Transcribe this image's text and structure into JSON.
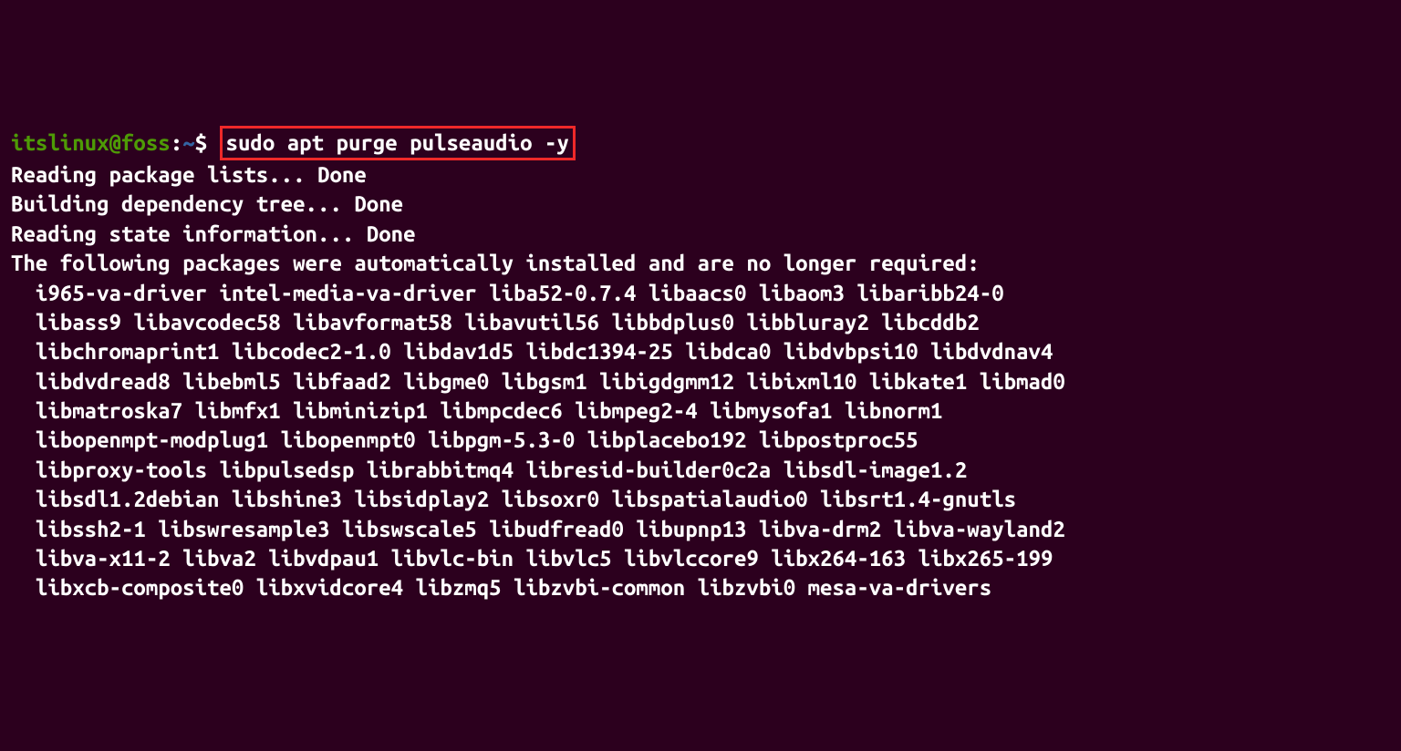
{
  "prompt": {
    "user_host": "itslinux@foss",
    "separator": ":",
    "path": "~",
    "dollar": "$"
  },
  "command": "sudo apt purge pulseaudio -y",
  "output": {
    "line1": "Reading package lists... Done",
    "line2": "Building dependency tree... Done",
    "line3": "Reading state information... Done",
    "line4": "The following packages were automatically installed and are no longer required:",
    "packages": {
      "row1": "i965-va-driver intel-media-va-driver liba52-0.7.4 libaacs0 libaom3 libaribb24-0",
      "row2": "libass9 libavcodec58 libavformat58 libavutil56 libbdplus0 libbluray2 libcddb2",
      "row3": "libchromaprint1 libcodec2-1.0 libdav1d5 libdc1394-25 libdca0 libdvbpsi10 libdvdnav4",
      "row4": "libdvdread8 libebml5 libfaad2 libgme0 libgsm1 libigdgmm12 libixml10 libkate1 libmad0",
      "row5": "libmatroska7 libmfx1 libminizip1 libmpcdec6 libmpeg2-4 libmysofa1 libnorm1",
      "row6": "libopenmpt-modplug1 libopenmpt0 libpgm-5.3-0 libplacebo192 libpostproc55",
      "row7": "libproxy-tools libpulsedsp librabbitmq4 libresid-builder0c2a libsdl-image1.2",
      "row8": "libsdl1.2debian libshine3 libsidplay2 libsoxr0 libspatialaudio0 libsrt1.4-gnutls",
      "row9": "libssh2-1 libswresample3 libswscale5 libudfread0 libupnp13 libva-drm2 libva-wayland2",
      "row10": "libva-x11-2 libva2 libvdpau1 libvlc-bin libvlc5 libvlccore9 libx264-163 libx265-199",
      "row11": "libxcb-composite0 libxvidcore4 libzmq5 libzvbi-common libzvbi0 mesa-va-drivers"
    }
  }
}
